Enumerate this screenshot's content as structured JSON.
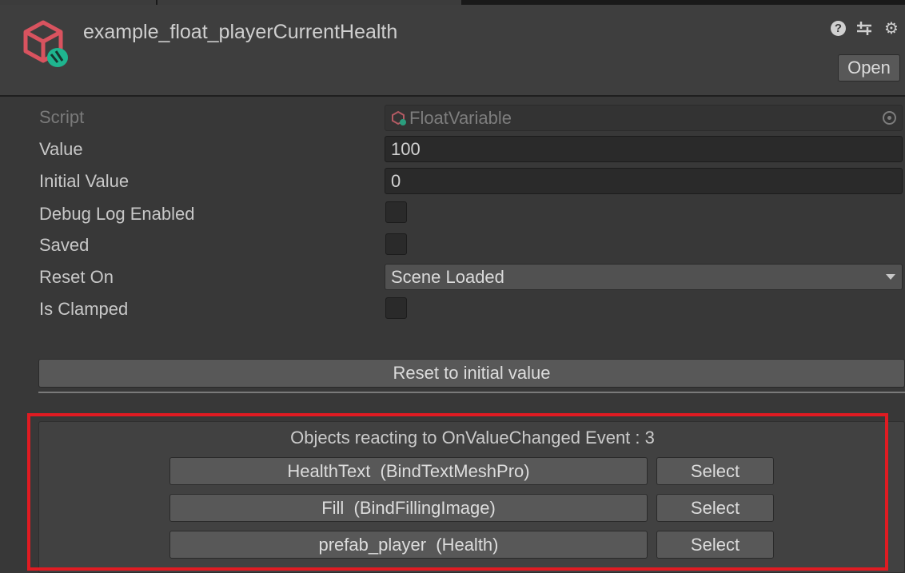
{
  "header": {
    "asset_name": "example_float_playerCurrentHealth",
    "help_glyph": "?",
    "settings_glyph": "⚙",
    "open_label": "Open"
  },
  "properties": {
    "script_label": "Script",
    "script_value": "FloatVariable",
    "value_label": "Value",
    "value_value": "100",
    "initial_value_label": "Initial Value",
    "initial_value_value": "0",
    "debug_log_label": "Debug Log Enabled",
    "debug_log_checked": false,
    "saved_label": "Saved",
    "saved_checked": false,
    "reset_on_label": "Reset On",
    "reset_on_value": "Scene Loaded",
    "is_clamped_label": "Is Clamped",
    "is_clamped_checked": false
  },
  "reset_button_label": "Reset to initial value",
  "events": {
    "title": "Objects reacting to OnValueChanged Event : 3",
    "items": [
      {
        "label": "HealthText  (BindTextMeshPro)",
        "select_label": "Select"
      },
      {
        "label": "Fill  (BindFillingImage)",
        "select_label": "Select"
      },
      {
        "label": "prefab_player  (Health)",
        "select_label": "Select"
      }
    ]
  },
  "colors": {
    "background": "#383838",
    "highlight_border": "#e01b22",
    "icon_red": "#d9535f",
    "icon_teal": "#1fb58f"
  }
}
